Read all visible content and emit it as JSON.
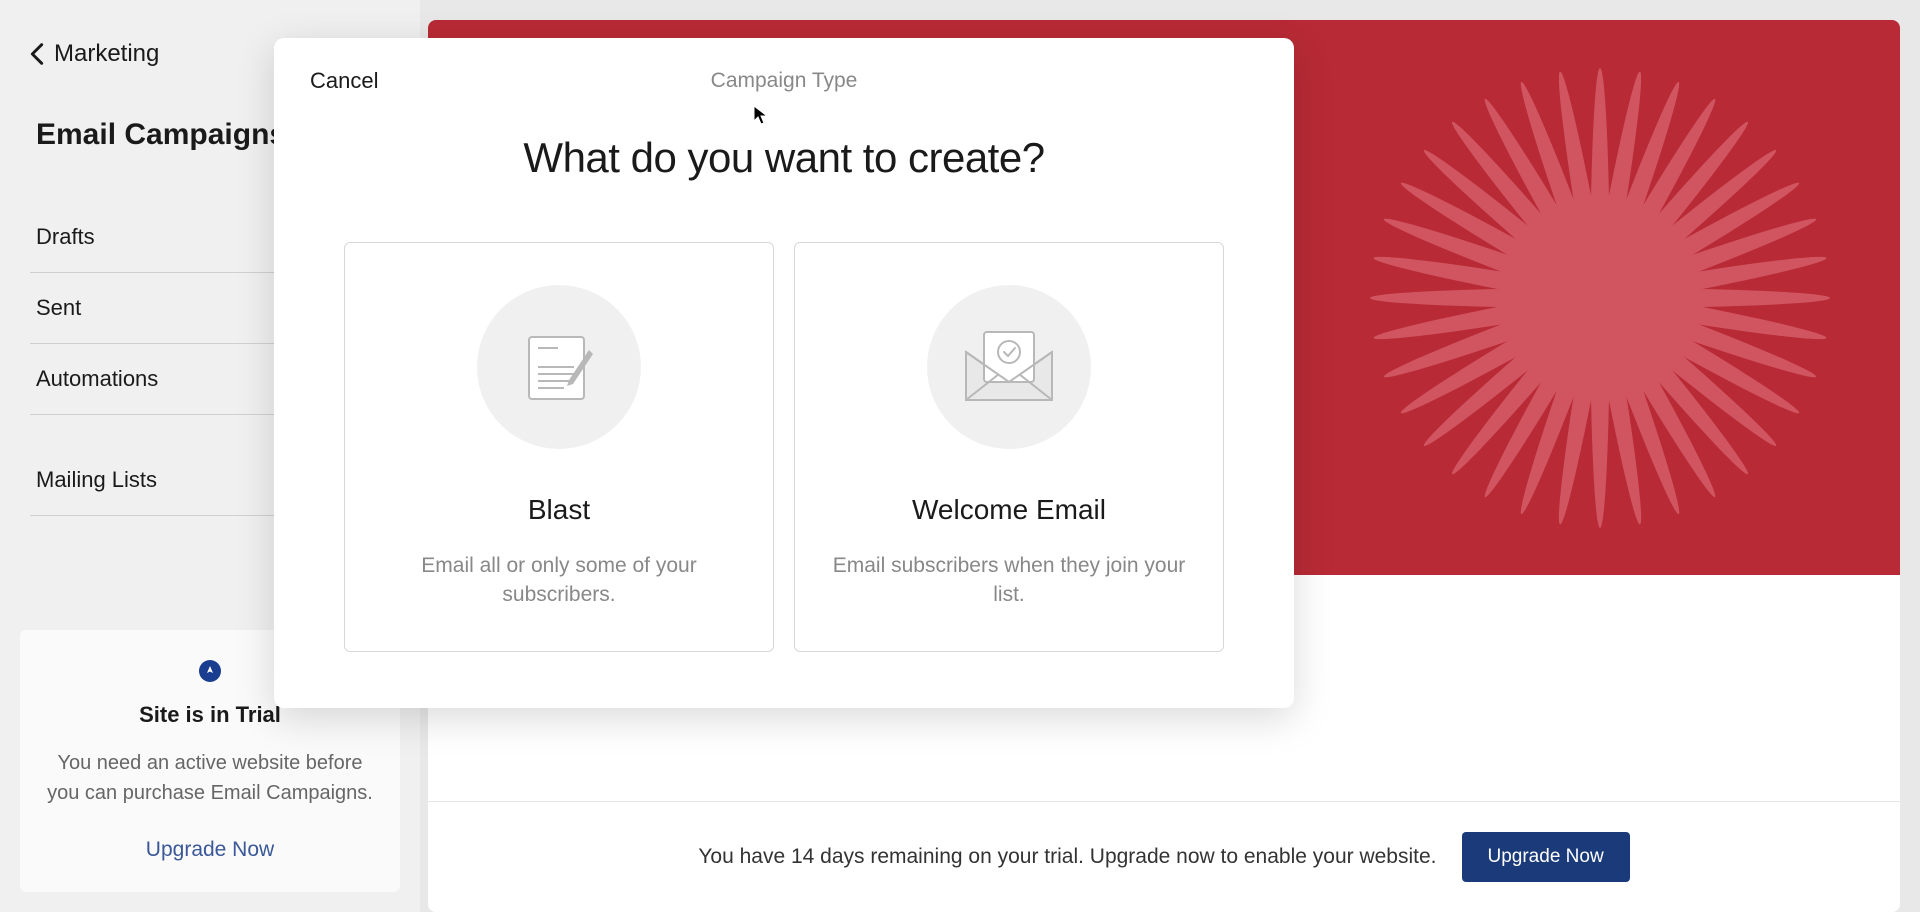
{
  "sidebar": {
    "backLabel": "Marketing",
    "pageTitle": "Email Campaigns",
    "nav": {
      "drafts": "Drafts",
      "sent": "Sent",
      "automations": "Automations",
      "mailingLists": "Mailing Lists"
    },
    "trialCard": {
      "title": "Site is in Trial",
      "body": "You need an active website before you can purchase Email Campaigns.",
      "link": "Upgrade Now"
    }
  },
  "trialBar": {
    "text": "You have 14 days remaining on your trial. Upgrade now to enable your website.",
    "button": "Upgrade Now"
  },
  "modal": {
    "cancel": "Cancel",
    "subtitle": "Campaign Type",
    "question": "What do you want to create?",
    "options": [
      {
        "title": "Blast",
        "desc": "Email all or only some of your subscribers."
      },
      {
        "title": "Welcome Email",
        "desc": "Email subscribers when they join your list."
      }
    ]
  },
  "colors": {
    "bannerBg": "#b82a35",
    "primaryBtn": "#1a3a7a",
    "link": "#3a5898"
  }
}
